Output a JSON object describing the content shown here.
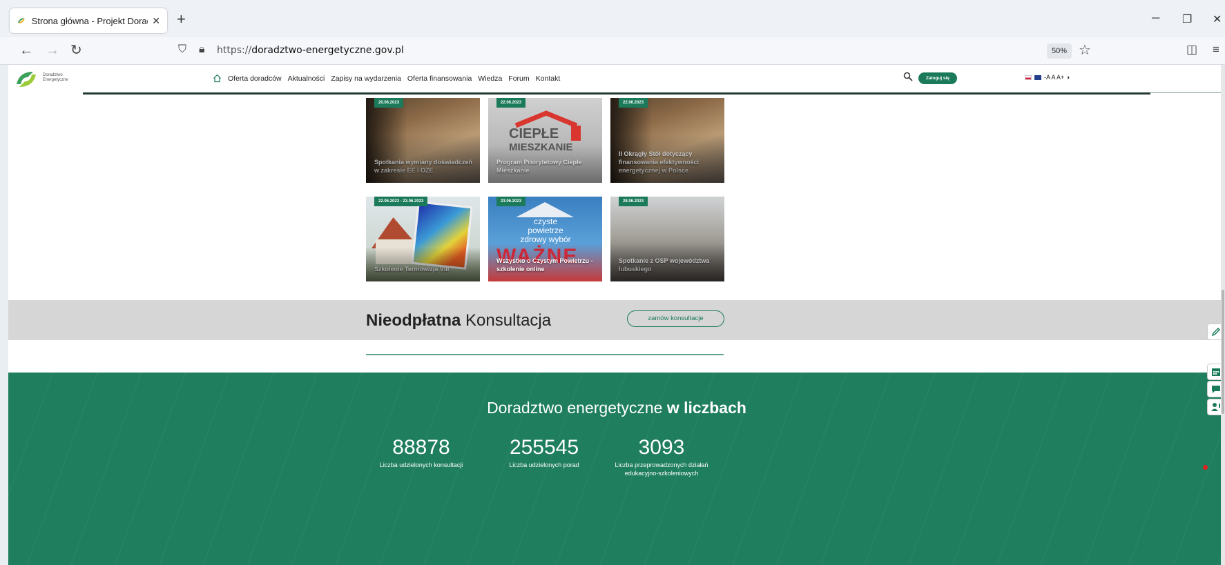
{
  "browser": {
    "tab_title": "Strona główna - Projekt Doradztwo",
    "url_prefix": "https://",
    "url_host": "doradztwo-energetyczne.gov.pl",
    "zoom": "50%"
  },
  "site": {
    "logo_line1": "Doradztwo",
    "logo_line2": "Energetyczne",
    "nav": [
      "Oferta doradców",
      "Aktualności",
      "Zapisy na wydarzenia",
      "Oferta finansowania",
      "Wiedza",
      "Forum",
      "Kontakt"
    ],
    "login_label": "Zaloguj się",
    "accessibility": "-A A A+ ◑"
  },
  "news": [
    {
      "date": "20.06.2023",
      "title": "Spotkania wymiany doświadczeń w zakresie EE i OZE",
      "image": "conference"
    },
    {
      "date": "22.06.2023",
      "title": "Program Priorytetowy Ciepłe Mieszkanie",
      "image": "cieple-mieszkanie"
    },
    {
      "date": "22.06.2023",
      "title": "II Okrągły Stół dotyczący finansowania efektywności energetycznej w Polsce",
      "image": "conference"
    },
    {
      "date": "22.06.2023 - 23.06.2023",
      "title": "Szkolenie Termowizja VIII",
      "image": "thermal-house"
    },
    {
      "date": "23.06.2023",
      "title": "Wszystko o Czystym Powietrzu - szkolenie online",
      "image": "czyste-powietrze"
    },
    {
      "date": "28.06.2023",
      "title": "Spotkanie z OSP województwa lubuskiego",
      "image": "audience"
    }
  ],
  "cieple_logo": {
    "line1": "CIEPŁE",
    "line2": "MIESZKANIE"
  },
  "czyste_logo": {
    "line1": "czyste powietrze",
    "line2": "zdrowy wybór",
    "big": "WAŻNE"
  },
  "consult": {
    "heading_bold": "Nieodpłatna",
    "heading_rest": " Konsultacja",
    "button": "zamów konsultacje"
  },
  "stats": {
    "title_regular": "Doradztwo energetyczne ",
    "title_bold": "w liczbach",
    "items": [
      {
        "value": "88878",
        "label": "Liczba udzielonych konsultacji"
      },
      {
        "value": "255545",
        "label": "Liczba udzielonych porad"
      },
      {
        "value": "3093",
        "label": "Liczba przeprowadzonych działań edukacyjno-szkoleniowych"
      }
    ]
  },
  "colors": {
    "brand_green": "#1b7a5a",
    "stats_bg": "#1e7e5e",
    "consult_bg": "#d6d6d6"
  }
}
